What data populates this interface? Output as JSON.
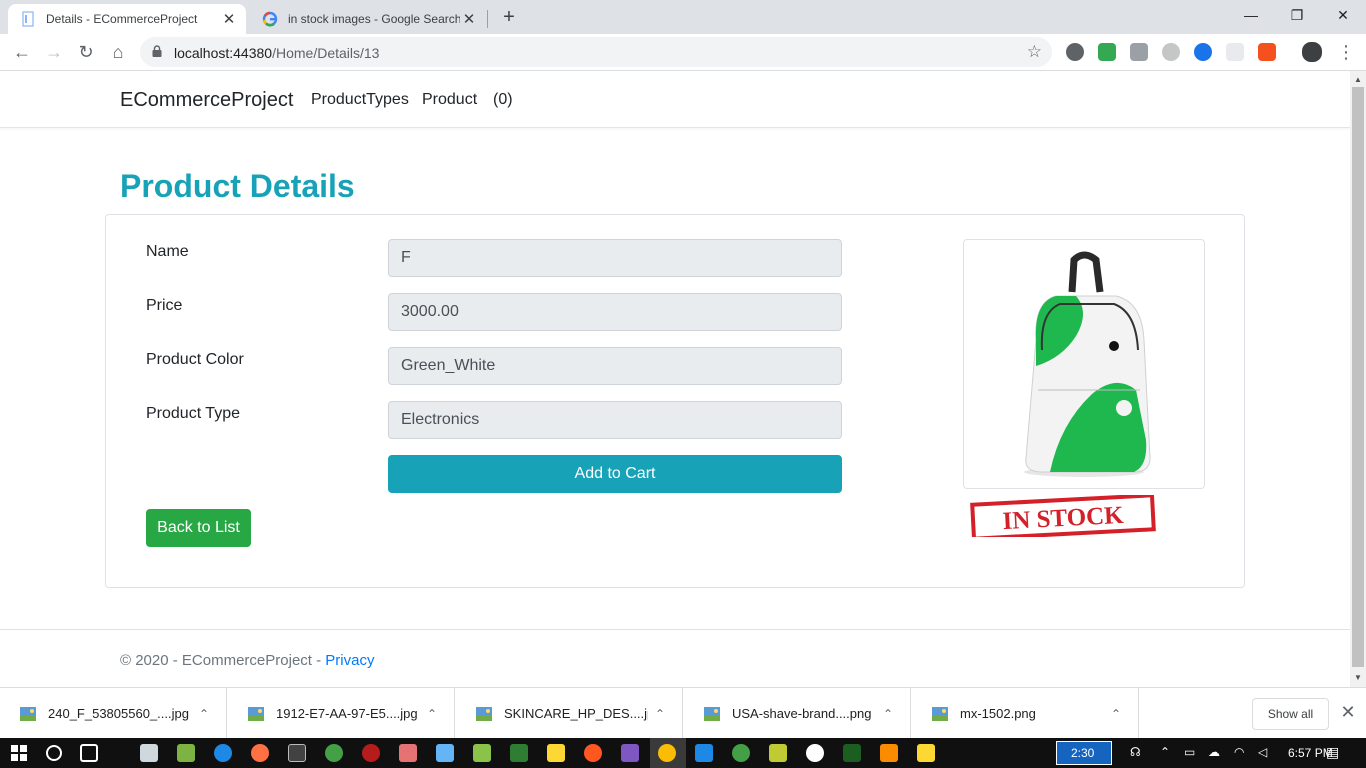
{
  "browser": {
    "tabs": [
      {
        "title": "Details - ECommerceProject",
        "active": true
      },
      {
        "title": "in stock images - Google Search",
        "active": false
      }
    ],
    "url_host": "localhost:44380",
    "url_path": "/Home/Details/13"
  },
  "site": {
    "brand": "ECommerceProject",
    "nav": [
      {
        "label": "ProductTypes"
      },
      {
        "label": "Product"
      },
      {
        "label": "(0)"
      }
    ]
  },
  "details": {
    "heading": "Product Details",
    "fields": [
      {
        "label": "Name",
        "value": "F"
      },
      {
        "label": "Price",
        "value": "3000.00"
      },
      {
        "label": "Product Color",
        "value": "Green_White"
      },
      {
        "label": "Product Type",
        "value": "Electronics"
      }
    ],
    "add_to_cart": "Add to Cart",
    "back_to_list": "Back to List",
    "stamp_text": "IN STOCK"
  },
  "footer": {
    "text": "© 2020 - ECommerceProject - ",
    "privacy": "Privacy"
  },
  "downloads": {
    "items": [
      {
        "name": "240_F_53805560_....jpg"
      },
      {
        "name": "1912-E7-AA-97-E5....jpg"
      },
      {
        "name": "SKINCARE_HP_DES....jpg"
      },
      {
        "name": "USA-shave-brand....png"
      },
      {
        "name": "mx-1502.png"
      }
    ],
    "show_all": "Show all"
  },
  "taskbar": {
    "timer": "2:30",
    "clock": "6:57 PM"
  },
  "colors": {
    "accent_teal": "#17a2b8",
    "success_green": "#28a745",
    "link_blue": "#007bff"
  }
}
